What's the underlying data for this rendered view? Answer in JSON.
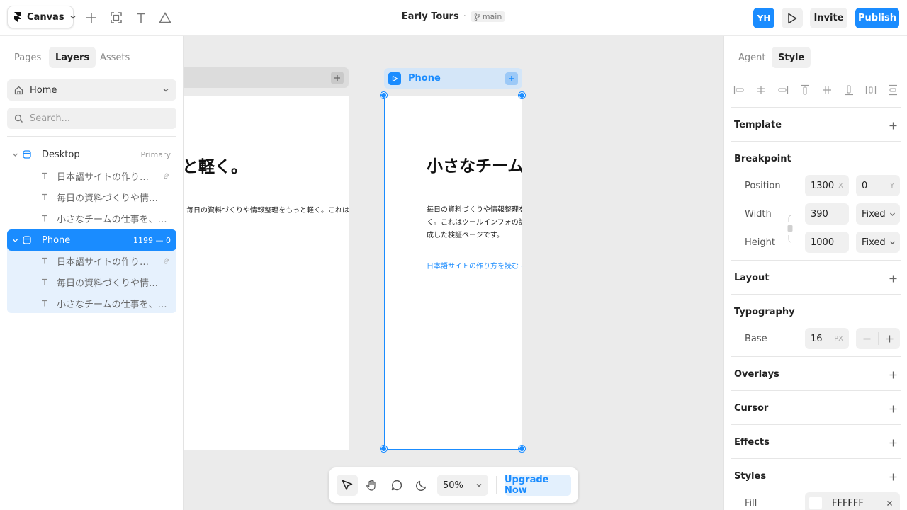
{
  "topbar": {
    "app_name": "Canvas",
    "doc_name": "Early Tours",
    "separator": "·",
    "branch": "main",
    "avatar_initials": "YH",
    "invite_label": "Invite",
    "publish_label": "Publish",
    "accent": "#1a8cff"
  },
  "left_panel": {
    "tabs": [
      {
        "label": "Pages",
        "active": false
      },
      {
        "label": "Layers",
        "active": true
      },
      {
        "label": "Assets",
        "active": false
      }
    ],
    "page_select": "Home",
    "search_placeholder": "Search...",
    "layers": [
      {
        "name": "Desktop",
        "type": "frame",
        "meta": "Primary",
        "expanded": true
      },
      {
        "name": "日本語サイトの作り方...",
        "type": "text",
        "linked": true
      },
      {
        "name": "毎日の資料づくりや情報整...",
        "type": "text"
      },
      {
        "name": "小さなチームの仕事を、も...",
        "type": "text"
      },
      {
        "name": "Phone",
        "type": "frame",
        "meta": "1199 — 0",
        "selected": true,
        "expanded": true
      },
      {
        "name": "日本語サイトの作り方...",
        "type": "text",
        "linked": true
      },
      {
        "name": "毎日の資料づくりや情報整...",
        "type": "text"
      },
      {
        "name": "小さなチームの仕事を、も...",
        "type": "text"
      }
    ]
  },
  "canvas": {
    "desktop_heading": "小さなチームの仕事を、もっと軽く。",
    "desktop_body": "毎日の資料づくりや情報整理をもっと軽く。これはツールインフォの記事用に",
    "phone_label": "Phone",
    "phone_heading": "小さなチームの仕事を、もっと軽く。",
    "phone_body": "毎日の資料づくりや情報整理をもっと軽く。これはツールインフォの記事用に作成した検証ページです。",
    "phone_link": "日本語サイトの作り方を読む →"
  },
  "bottom_toolbar": {
    "zoom": "50%",
    "upgrade_label": "Upgrade Now",
    "tools": [
      "pointer-icon",
      "hand-icon",
      "comment-icon",
      "moon-icon"
    ]
  },
  "right_panel": {
    "tabs": [
      {
        "label": "Agent",
        "active": false
      },
      {
        "label": "Style",
        "active": true
      }
    ],
    "sections": {
      "template": "Template",
      "breakpoint": "Breakpoint",
      "layout": "Layout",
      "typography": "Typography",
      "overlays": "Overlays",
      "cursor": "Cursor",
      "effects": "Effects",
      "styles": "Styles"
    },
    "position": {
      "label": "Position",
      "x": "1300",
      "x_unit": "X",
      "y": "0",
      "y_unit": "Y"
    },
    "width": {
      "label": "Width",
      "value": "390",
      "mode": "Fixed"
    },
    "height": {
      "label": "Height",
      "value": "1000",
      "mode": "Fixed"
    },
    "base": {
      "label": "Base",
      "value": "16",
      "unit": "PX"
    },
    "fill": {
      "label": "Fill",
      "value": "FFFFFF"
    }
  }
}
